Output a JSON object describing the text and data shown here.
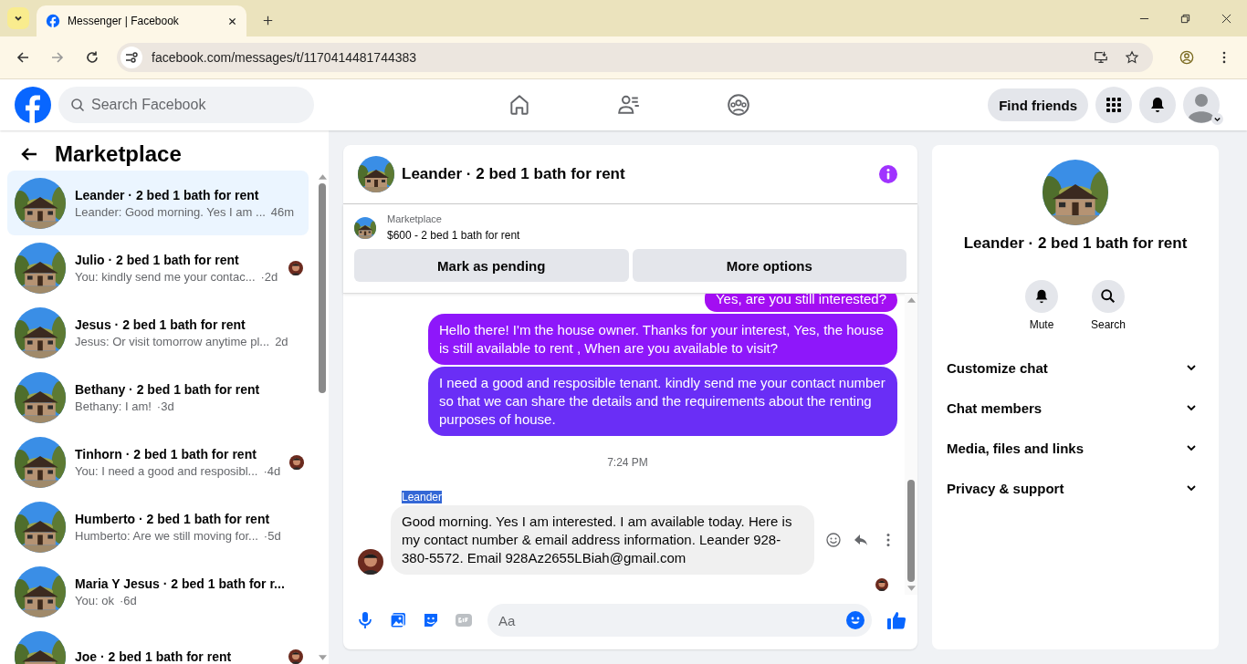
{
  "browser": {
    "tab_title": "Messenger | Facebook",
    "url": "facebook.com/messages/t/1170414481744383"
  },
  "header": {
    "search_placeholder": "Search Facebook",
    "find_friends": "Find friends"
  },
  "sidebar": {
    "title": "Marketplace",
    "conversations": [
      {
        "name": "Leander · 2 bed 1 bath for rent",
        "preview": "Leander: Good morning. Yes I am ...",
        "time": "46m",
        "selected": true,
        "seen": false
      },
      {
        "name": "Julio · 2 bed 1 bath for rent",
        "preview": "You: kindly send me your contac...",
        "time": "·2d",
        "selected": false,
        "seen": true
      },
      {
        "name": "Jesus · 2 bed 1 bath for rent",
        "preview": "Jesus: Or visit tomorrow anytime pl...",
        "time": "2d",
        "selected": false,
        "seen": false
      },
      {
        "name": "Bethany · 2 bed 1 bath for rent",
        "preview": "Bethany: I am!",
        "time": "·3d",
        "selected": false,
        "seen": false
      },
      {
        "name": "Tinhorn · 2 bed 1 bath for rent",
        "preview": "You: I need a good and resposibl...",
        "time": "·4d",
        "selected": false,
        "seen": true
      },
      {
        "name": "Humberto · 2 bed 1 bath for rent",
        "preview": "Humberto: Are we still moving for...",
        "time": "·5d",
        "selected": false,
        "seen": false
      },
      {
        "name": "Maria Y Jesus · 2 bed 1 bath for r...",
        "preview": "You: ok",
        "time": "·6d",
        "selected": false,
        "seen": false
      },
      {
        "name": "Joe · 2 bed 1 bath for rent",
        "selected": false,
        "seen": true
      }
    ]
  },
  "chat": {
    "title": "Leander · 2 bed 1 bath for rent",
    "listing": {
      "label": "Marketplace",
      "title": "$600 - 2 bed 1 bath for rent"
    },
    "buttons": [
      "Mark as pending",
      "More options"
    ],
    "messages": [
      {
        "kind": "outgoing",
        "text": "Yes, are you still interested?"
      },
      {
        "kind": "outgoing",
        "text": "Hello there! I'm the house owner. Thanks for your interest, Yes, the house is still available to rent , When are you available to visit?"
      },
      {
        "kind": "outgoing",
        "text": "I need a good and resposible tenant.  kindly send me your contact number so that we can share the details and the requirements about the renting purposes of house."
      },
      {
        "kind": "time",
        "text": "7:24 PM"
      },
      {
        "kind": "incoming",
        "sender": "Leander",
        "sender_highlighted": true,
        "text": "Good morning.  Yes I am interested.  I am available today. Here is my contact number & email address information. Leander 928-380-5572. Email 928Az2655LBiah@gmail.com"
      }
    ],
    "composer_placeholder": "Aa"
  },
  "details": {
    "name": "Leander · 2 bed 1 bath for rent",
    "actions": [
      {
        "kind": "mute",
        "label": "Mute"
      },
      {
        "kind": "search",
        "label": "Search"
      }
    ],
    "sections": [
      "Customize chat",
      "Chat members",
      "Media, files and links",
      "Privacy & support"
    ]
  }
}
